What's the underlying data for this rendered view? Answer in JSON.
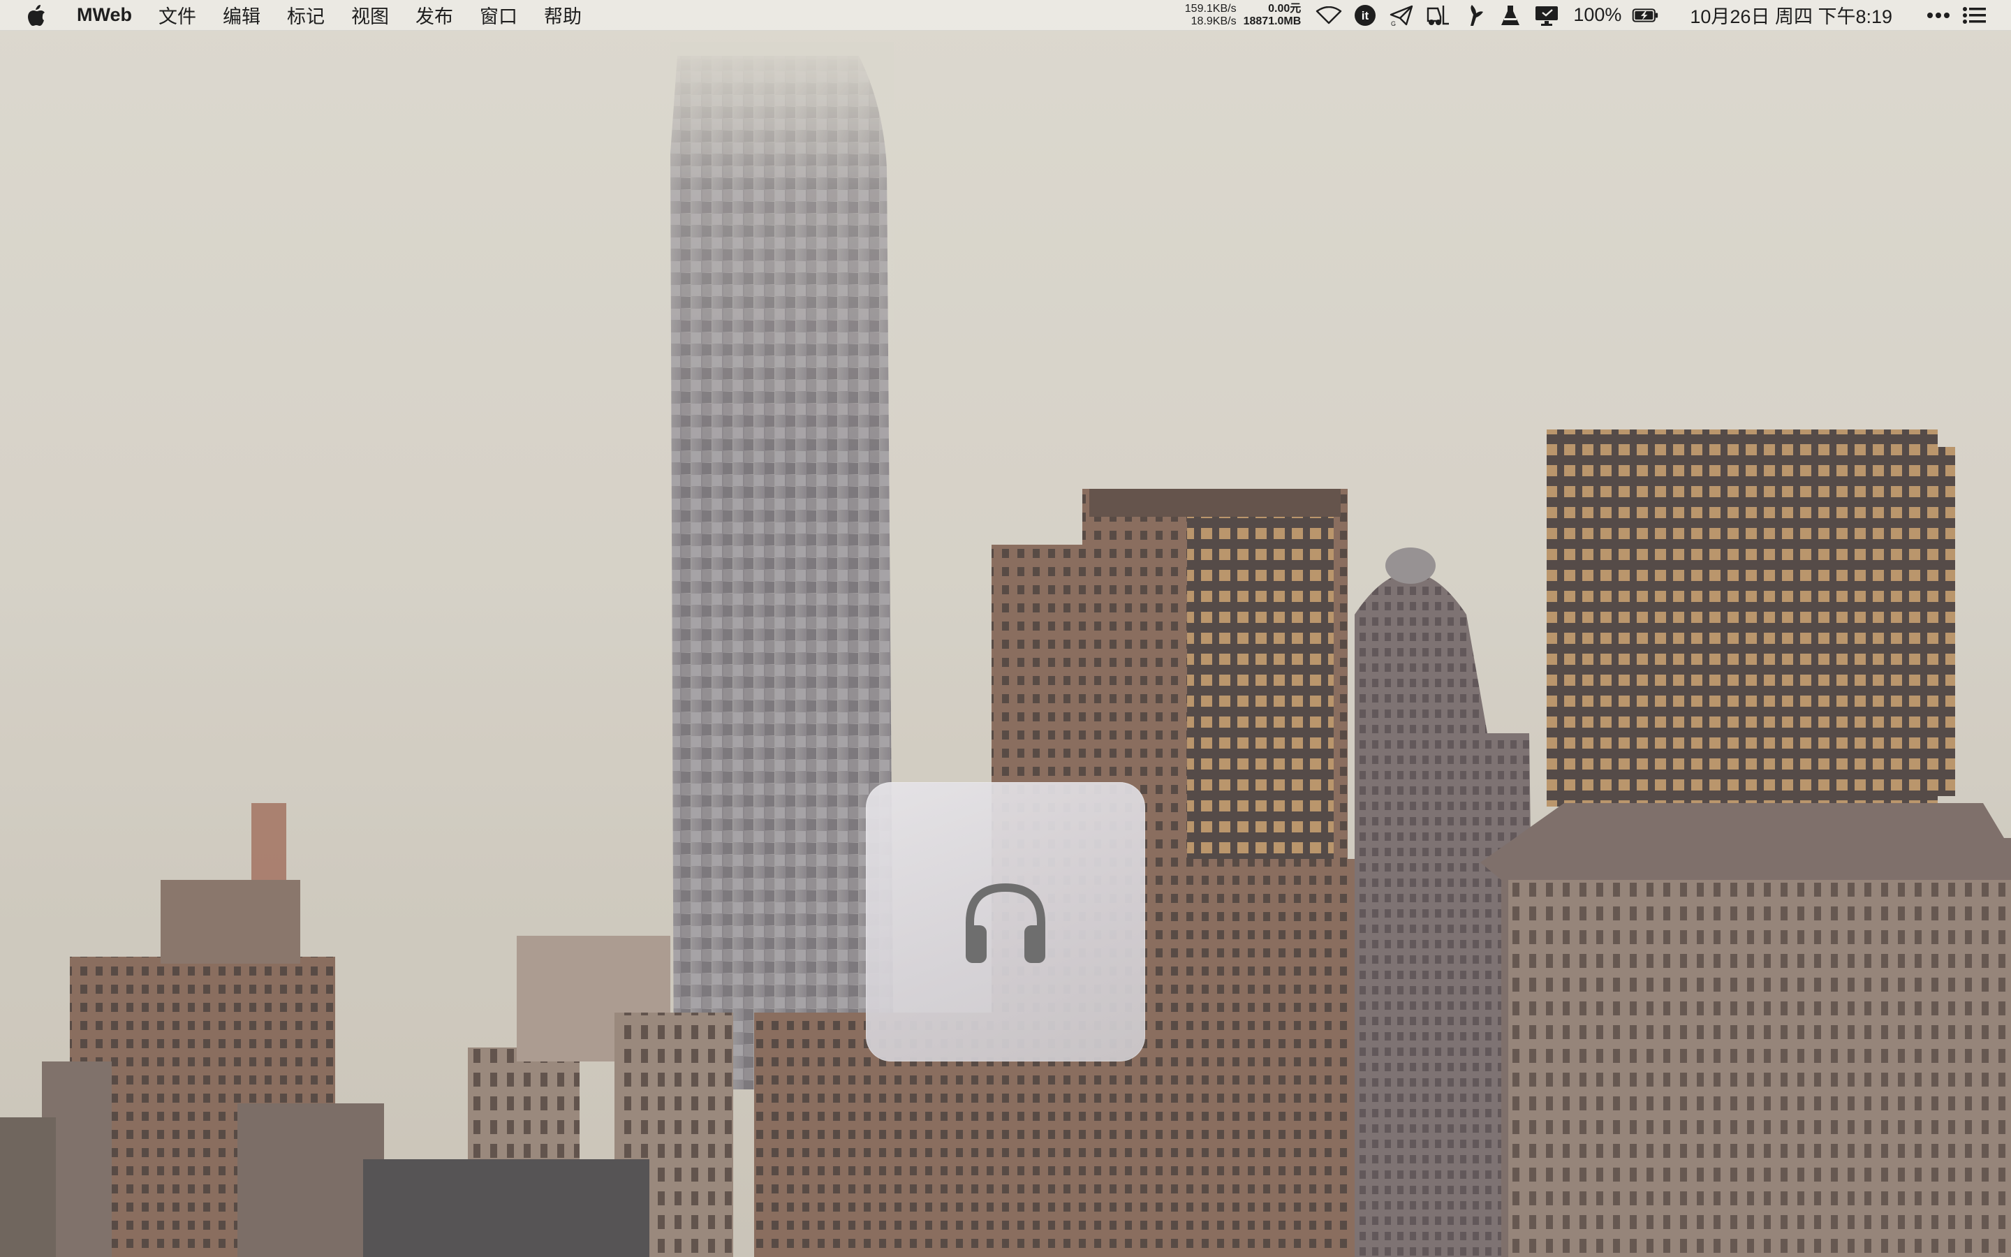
{
  "menubar": {
    "app_name": "MWeb",
    "menus": [
      "文件",
      "编辑",
      "标记",
      "视图",
      "发布",
      "窗口",
      "帮助"
    ],
    "net_up": "159.1KB/s",
    "net_down": "18.9KB/s",
    "cost_top": "0.00元",
    "cost_bottom": "18871.0MB",
    "battery_percent": "100%",
    "clock": "10月26日 周四 下午8:19"
  },
  "tray_icons": [
    "wifi-icon",
    "it-badge-icon",
    "paper-plane-icon",
    "forklift-icon",
    "bunny-icon",
    "flask-icon",
    "display-icon",
    "battery-charging-icon",
    "more-dots-icon",
    "notification-list-icon"
  ],
  "hud": {
    "icon": "headphones-icon"
  },
  "wallpaper": {
    "subject": "city-skyline-icon"
  },
  "colors": {
    "menubar_bg": "#ECEAE5",
    "hud_bg": "#DCD9DD",
    "headphones": "#6E6E6E"
  }
}
